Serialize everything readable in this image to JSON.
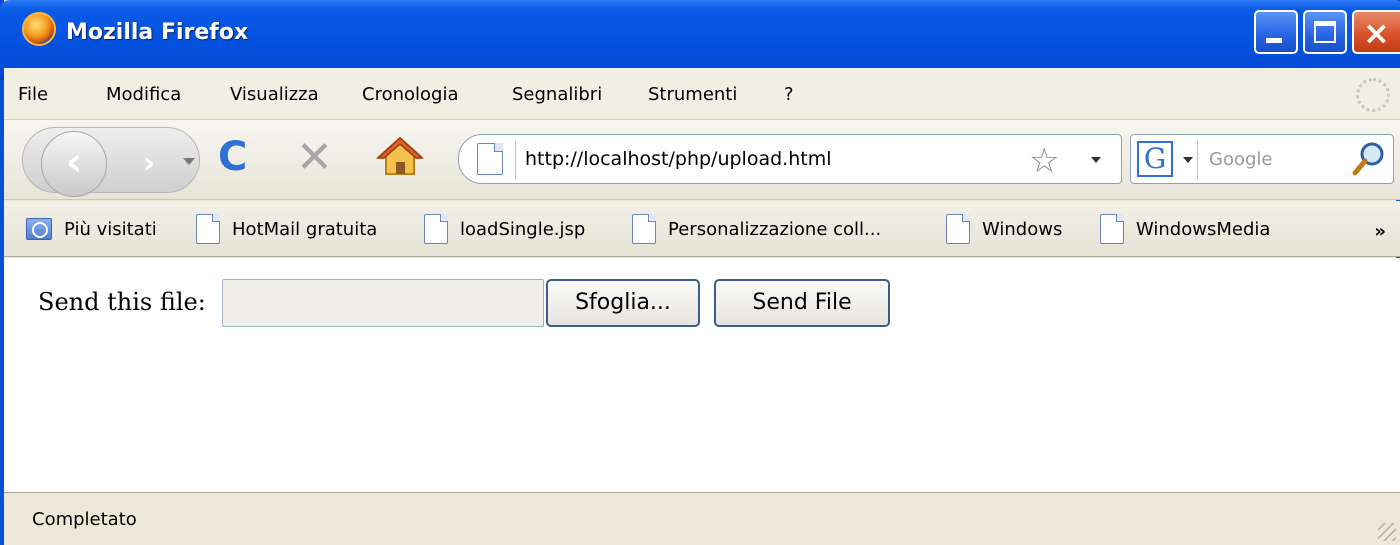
{
  "window": {
    "title": "Mozilla Firefox"
  },
  "menu": {
    "items": [
      "File",
      "Modifica",
      "Visualizza",
      "Cronologia",
      "Segnalibri",
      "Strumenti",
      "?"
    ]
  },
  "navbar": {
    "url": "http://localhost/php/upload.html",
    "search_placeholder": "Google",
    "search_engine_letter": "G"
  },
  "bookmarks": {
    "items": [
      "Più visitati",
      "HotMail gratuita",
      "loadSingle.jsp",
      "Personalizzazione coll...",
      "Windows",
      "WindowsMedia"
    ],
    "overflow": "»"
  },
  "content": {
    "label": "Send this file:",
    "file_value": "",
    "browse_label": "Sfoglia...",
    "submit_label": "Send File"
  },
  "status": {
    "text": "Completato"
  },
  "colors": {
    "titlebar": "#0552e0",
    "window_frame": "#0a4fd8",
    "close_button": "#d9532b",
    "reload_icon": "#2f6fd8"
  },
  "icons": {
    "app": "firefox-logo-icon",
    "back": "back-arrow-icon",
    "forward": "forward-arrow-icon",
    "reload": "reload-icon",
    "stop": "stop-icon",
    "home": "home-icon",
    "bookmark_star": "star-icon",
    "search": "magnifier-icon"
  }
}
